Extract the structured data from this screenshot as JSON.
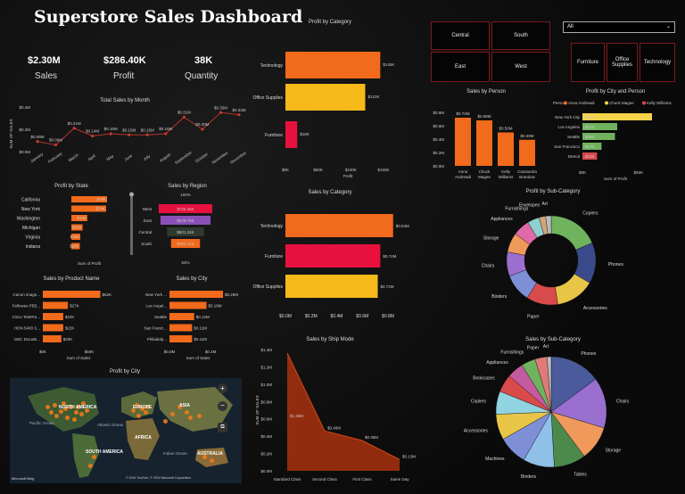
{
  "title": "Superstore Sales Dashboard",
  "kpis": [
    {
      "value": "$2.30M",
      "label": "Sales"
    },
    {
      "value": "$286.40K",
      "label": "Profit"
    },
    {
      "value": "38K",
      "label": "Quantity"
    }
  ],
  "region_buttons": [
    "Central",
    "South",
    "East",
    "West"
  ],
  "category_buttons": [
    "Furniture",
    "Office Supplies",
    "Technology"
  ],
  "dropdown": {
    "selected": "All"
  },
  "sales_by_month": {
    "title": "Total Sales by Month",
    "y_axis": "SUM OF SALES",
    "y_ticks": [
      "$0.4M",
      "$0.2M",
      "$0.0M"
    ],
    "months": [
      "January",
      "February",
      "March",
      "April",
      "May",
      "June",
      "July",
      "August",
      "September",
      "October",
      "November",
      "December"
    ],
    "values": [
      0.09,
      0.06,
      0.21,
      0.14,
      0.16,
      0.15,
      0.15,
      0.16,
      0.31,
      0.2,
      0.35,
      0.33
    ],
    "labels": [
      "$0.09M",
      "$0.06M",
      "$0.21M",
      "$0.14M",
      "$0.16M",
      "$0.15M",
      "$0.15M",
      "$0.16M",
      "$0.31M",
      "$0.20M",
      "$0.35M",
      "$0.33M"
    ]
  },
  "profit_by_category": {
    "title": "Profit by Category",
    "categories": [
      "Technology",
      "Office Supplies",
      "Furniture"
    ],
    "values": [
      145,
      122,
      18
    ],
    "labels": [
      "$145K",
      "$122K",
      "$18K"
    ],
    "ticks": [
      "$0K",
      "$50K",
      "$100K",
      "$150K"
    ],
    "xlabel": "Profit"
  },
  "sales_by_person": {
    "title": "Sales by Person",
    "y_ticks": [
      "$0.8M",
      "$0.6M",
      "$0.4M",
      "$0.2M",
      "$0.0M"
    ],
    "persons": [
      "Anna Andreadi",
      "Chuck Magee",
      "Kelly Williams",
      "Cassandra Brandow"
    ],
    "values": [
      0.72,
      0.68,
      0.5,
      0.39
    ],
    "labels": [
      "$0.72M",
      "$0.68M",
      "$0.50M",
      "$0.39M"
    ]
  },
  "profit_by_city_person": {
    "title": "Profit by City and Person",
    "legend_title": "Person",
    "legend": [
      "Anna Andreadi",
      "Chuck Magee",
      "Kelly Williams"
    ],
    "cities": [
      "New York City",
      "Los Angeles",
      "Seattle",
      "San Francisco",
      "Detroit"
    ],
    "values": [
      62,
      31,
      29,
      17,
      13
    ],
    "labels": [
      "$62K",
      "$31K",
      "$29K",
      "$17K",
      "$13K"
    ],
    "ticks": [
      "$0K",
      "$50K"
    ],
    "xlabel": "Sum of Profit"
  },
  "profit_by_state": {
    "title": "Profit by State",
    "states": [
      "California",
      "New York",
      "Washington",
      "Michigan",
      "Virginia",
      "Indiana"
    ],
    "values": [
      76,
      74,
      34,
      24,
      19,
      18
    ],
    "labels": [
      "$76K",
      "$74K",
      "$34K",
      "$24K",
      "$19K",
      "$18K"
    ],
    "xlabel": "Sum of Profit"
  },
  "sales_by_region": {
    "title": "Sales by Region",
    "regions": [
      "West",
      "East",
      "Central",
      "South"
    ],
    "values": [
      725.46,
      678.78,
      501.24,
      391.72
    ],
    "labels": [
      "$725.46K",
      "$678.78K",
      "$501.24K",
      "$391.72K"
    ],
    "top_pct": "100%",
    "bottom_pct": "54%"
  },
  "sales_by_category": {
    "title": "Sales by Category",
    "categories": [
      "Technology",
      "Furniture",
      "Office Supplies"
    ],
    "values": [
      0.84,
      0.74,
      0.72
    ],
    "labels": [
      "$0.84M",
      "$0.74M",
      "$0.72M"
    ],
    "ticks": [
      "$0.0M",
      "$0.2M",
      "$0.4M",
      "$0.6M",
      "$0.8M"
    ]
  },
  "sales_by_product": {
    "title": "Sales by Product Name",
    "products": [
      "Canon image...",
      "Fellowes PB5...",
      "Cisco TelePre...",
      "HON 5400 S...",
      "GBC DocuBi..."
    ],
    "values": [
      62,
      27,
      22,
      22,
      20
    ],
    "labels": [
      "$62K",
      "$27K",
      "$22K",
      "$22K",
      "$20K"
    ],
    "ticks": [
      "$0K",
      "$50K"
    ],
    "xlabel": "Sum of Sales"
  },
  "sales_by_city": {
    "title": "Sales by City",
    "cities": [
      "New York ...",
      "Los Angel...",
      "Seattle",
      "San Franci...",
      "Philadelp..."
    ],
    "values": [
      0.26,
      0.18,
      0.12,
      0.11,
      0.11
    ],
    "labels": [
      "$0.26M",
      "$0.18M",
      "$0.12M",
      "$0.11M",
      "$0.11M"
    ],
    "ticks": [
      "$0.0M",
      "$0.2M"
    ],
    "xlabel": "Sum of Sales"
  },
  "sales_by_ship_mode": {
    "title": "Sales by Ship Mode",
    "y_axis": "SUM OF SALES",
    "y_ticks": [
      "$1.4M",
      "$1.2M",
      "$1.0M",
      "$0.8M",
      "$0.6M",
      "$0.4M",
      "$0.2M",
      "$0.0M"
    ],
    "modes": [
      "Standard Class",
      "Second Class",
      "First Class",
      "Same Day"
    ],
    "values": [
      1.36,
      0.46,
      0.35,
      0.13
    ],
    "labels": [
      "$1.36M",
      "$0.46M",
      "$0.35M",
      "$0.13M"
    ]
  },
  "map": {
    "title": "Profit by City",
    "labels": [
      "NORTH AMERICA",
      "EUROPE",
      "ASIA",
      "AFRICA",
      "SOUTH AMERICA",
      "AUSTRALIA",
      "Atlantic Ocean",
      "Pacific Ocean",
      "Indian Ocean"
    ],
    "credit": "© 2024 TomTom, © 2024 Microsoft Corporation",
    "brand": "Microsoft Bing"
  },
  "profit_by_subcat": {
    "title": "Profit by Sub-Category",
    "labels": [
      "Copiers",
      "Phones",
      "Accessories",
      "Paper",
      "Binders",
      "Chairs",
      "Storage",
      "Appliances",
      "Furnishings",
      "Envelopes",
      "Art"
    ],
    "values": [
      55,
      44,
      42,
      34,
      30,
      26,
      21,
      18,
      13,
      7,
      6
    ],
    "colors": [
      "#6fb35f",
      "#3b4a8a",
      "#e8c547",
      "#d94a4a",
      "#7f8fd6",
      "#9a6fd0",
      "#ef9a5a",
      "#e06aa8",
      "#8fd0d0",
      "#d0a878",
      "#bcbcbc"
    ]
  },
  "sales_by_subcat": {
    "title": "Sales by Sub-Category",
    "labels": [
      "Phones",
      "Chairs",
      "Storage",
      "Tables",
      "Binders",
      "Machines",
      "Accessories",
      "Copiers",
      "Bookcases",
      "Appliances",
      "Furnishings",
      "Paper",
      "Art"
    ],
    "values": [
      330,
      328,
      224,
      207,
      203,
      189,
      167,
      150,
      115,
      107,
      92,
      78,
      27
    ],
    "colors": [
      "#4a5a9a",
      "#9a6fd0",
      "#ef9a5a",
      "#4c8a4c",
      "#8fc0e8",
      "#7f8fd6",
      "#e8c547",
      "#8fd4e0",
      "#d94a4a",
      "#c45ba0",
      "#6fb35f",
      "#e07a7a",
      "#bcbcbc"
    ]
  }
}
